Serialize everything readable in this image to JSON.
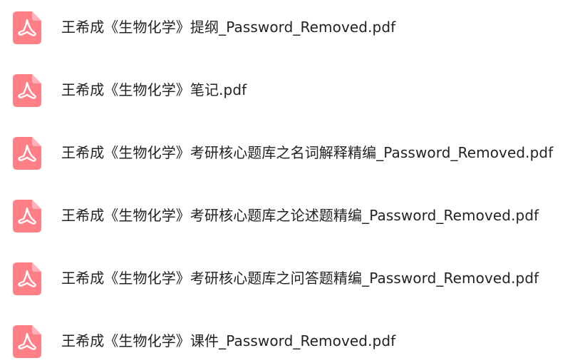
{
  "files": [
    {
      "name": "王希成《生物化学》提纲_Password_Removed.pdf",
      "icon": "pdf-file-icon"
    },
    {
      "name": "王希成《生物化学》笔记.pdf",
      "icon": "pdf-file-icon"
    },
    {
      "name": "王希成《生物化学》考研核心题库之名词解释精编_Password_Removed.pdf",
      "icon": "pdf-file-icon"
    },
    {
      "name": "王希成《生物化学》考研核心题库之论述题精编_Password_Removed.pdf",
      "icon": "pdf-file-icon"
    },
    {
      "name": "王希成《生物化学》考研核心题库之问答题精编_Password_Removed.pdf",
      "icon": "pdf-file-icon"
    },
    {
      "name": "王希成《生物化学》课件_Password_Removed.pdf",
      "icon": "pdf-file-icon"
    }
  ],
  "colors": {
    "icon_background": "#ff7f87",
    "icon_symbol": "#ffffff",
    "text": "#222222"
  }
}
